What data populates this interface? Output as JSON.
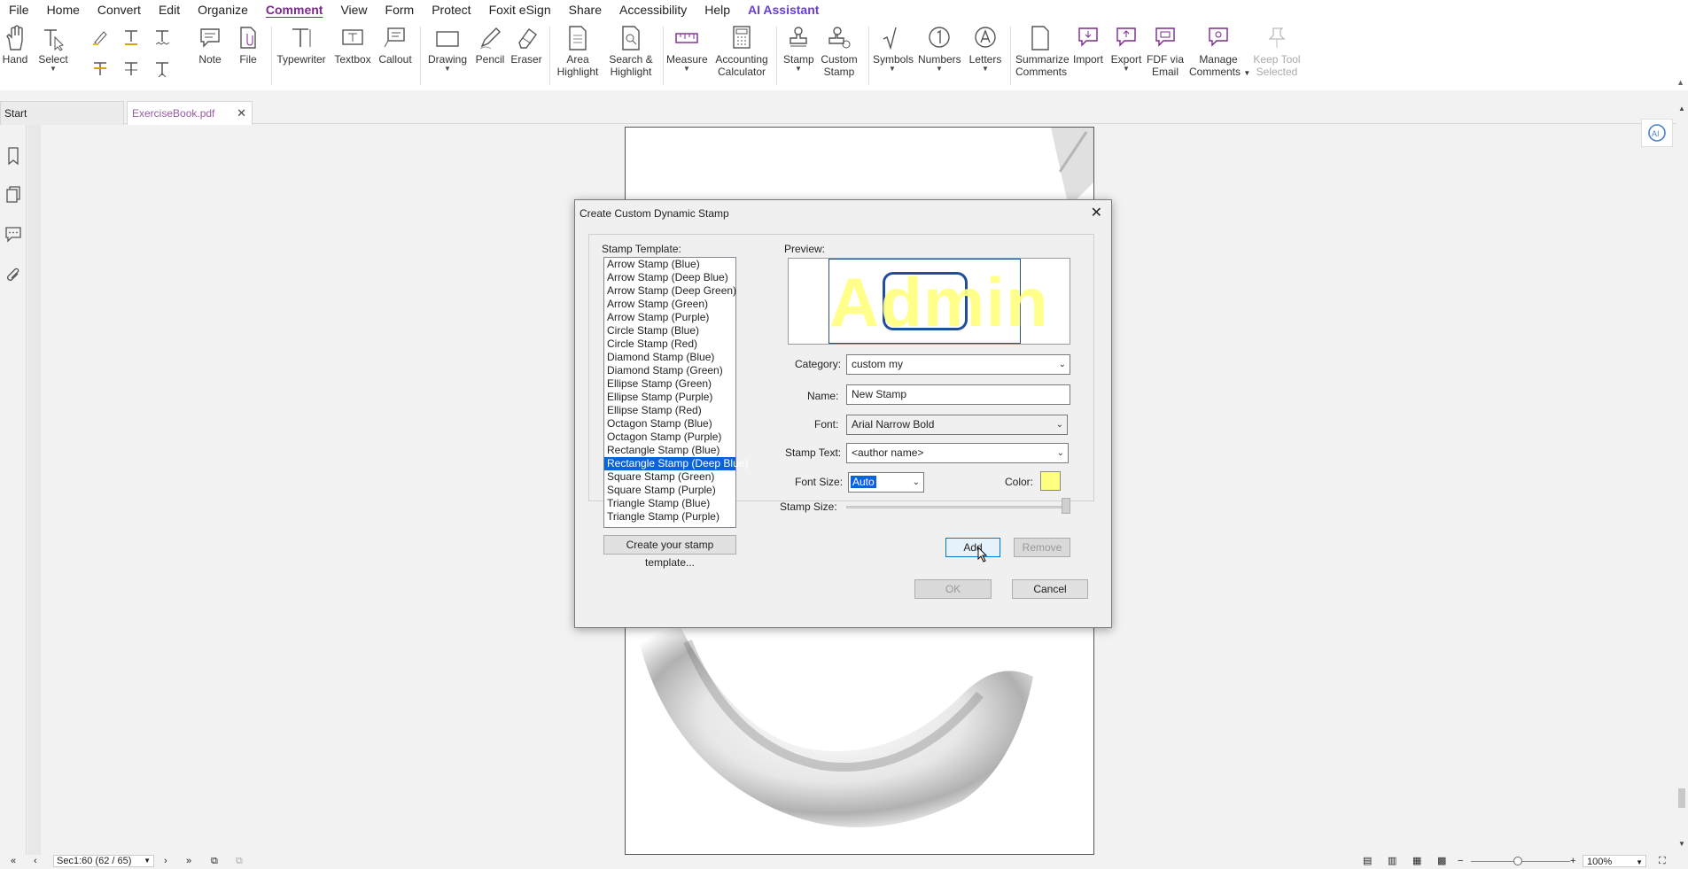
{
  "menu": [
    "File",
    "Home",
    "Convert",
    "Edit",
    "Organize",
    "Comment",
    "View",
    "Form",
    "Protect",
    "Foxit eSign",
    "Share",
    "Accessibility",
    "Help",
    "AI Assistant"
  ],
  "ribbon": {
    "hand": "Hand",
    "select": "Select",
    "note": "Note",
    "file": "File",
    "typewriter": "Typewriter",
    "textbox": "Textbox",
    "callout": "Callout",
    "drawing": "Drawing",
    "pencil": "Pencil",
    "eraser": "Eraser",
    "area_highlight_1": "Area",
    "area_highlight_2": "Highlight",
    "search_highlight_1": "Search &",
    "search_highlight_2": "Highlight",
    "measure": "Measure",
    "accounting_1": "Accounting",
    "accounting_2": "Calculator",
    "stamp": "Stamp",
    "custom_stamp_1": "Custom",
    "custom_stamp_2": "Stamp",
    "symbols": "Symbols",
    "numbers": "Numbers",
    "letters": "Letters",
    "summarize_1": "Summarize",
    "summarize_2": "Comments",
    "import": "Import",
    "export": "Export",
    "fdf_1": "FDF via",
    "fdf_2": "Email",
    "manage_1": "Manage",
    "manage_2": "Comments",
    "keep_1": "Keep Tool",
    "keep_2": "Selected"
  },
  "tabs": {
    "start": "Start",
    "doc": "ExerciseBook.pdf"
  },
  "dialog": {
    "title": "Create Custom Dynamic Stamp",
    "template_label": "Stamp Template:",
    "templates": [
      "Arrow Stamp (Blue)",
      "Arrow Stamp (Deep Blue)",
      "Arrow Stamp (Deep Green)",
      "Arrow Stamp (Green)",
      "Arrow Stamp (Purple)",
      "Circle Stamp (Blue)",
      "Circle Stamp (Red)",
      "Diamond Stamp (Blue)",
      "Diamond Stamp (Green)",
      "Ellipse Stamp (Green)",
      "Ellipse Stamp (Purple)",
      "Ellipse Stamp (Red)",
      "Octagon Stamp (Blue)",
      "Octagon Stamp (Purple)",
      "Rectangle Stamp (Blue)",
      "Rectangle Stamp (Deep Blue)",
      "Square Stamp (Green)",
      "Square Stamp (Purple)",
      "Triangle Stamp (Blue)",
      "Triangle Stamp (Purple)"
    ],
    "selected_template": "Rectangle Stamp (Deep Blue)",
    "create_template_button": "Create your stamp template...",
    "preview_label": "Preview:",
    "preview_text": "Admin",
    "category_label": "Category:",
    "category_value": "custom my",
    "name_label": "Name:",
    "name_value": "New Stamp",
    "font_label": "Font:",
    "font_value": "Arial Narrow Bold",
    "stamp_text_label": "Stamp Text:",
    "stamp_text_value": "<author name>",
    "font_size_label": "Font Size:",
    "font_size_value": "Auto",
    "color_label": "Color:",
    "color_value": "#ffff80",
    "stamp_size_label": "Stamp Size:",
    "add_button": "Add",
    "remove_button": "Remove",
    "ok_button": "OK",
    "cancel_button": "Cancel"
  },
  "status": {
    "page": "Sec1:60 (62 / 65)",
    "zoom": "100%"
  }
}
